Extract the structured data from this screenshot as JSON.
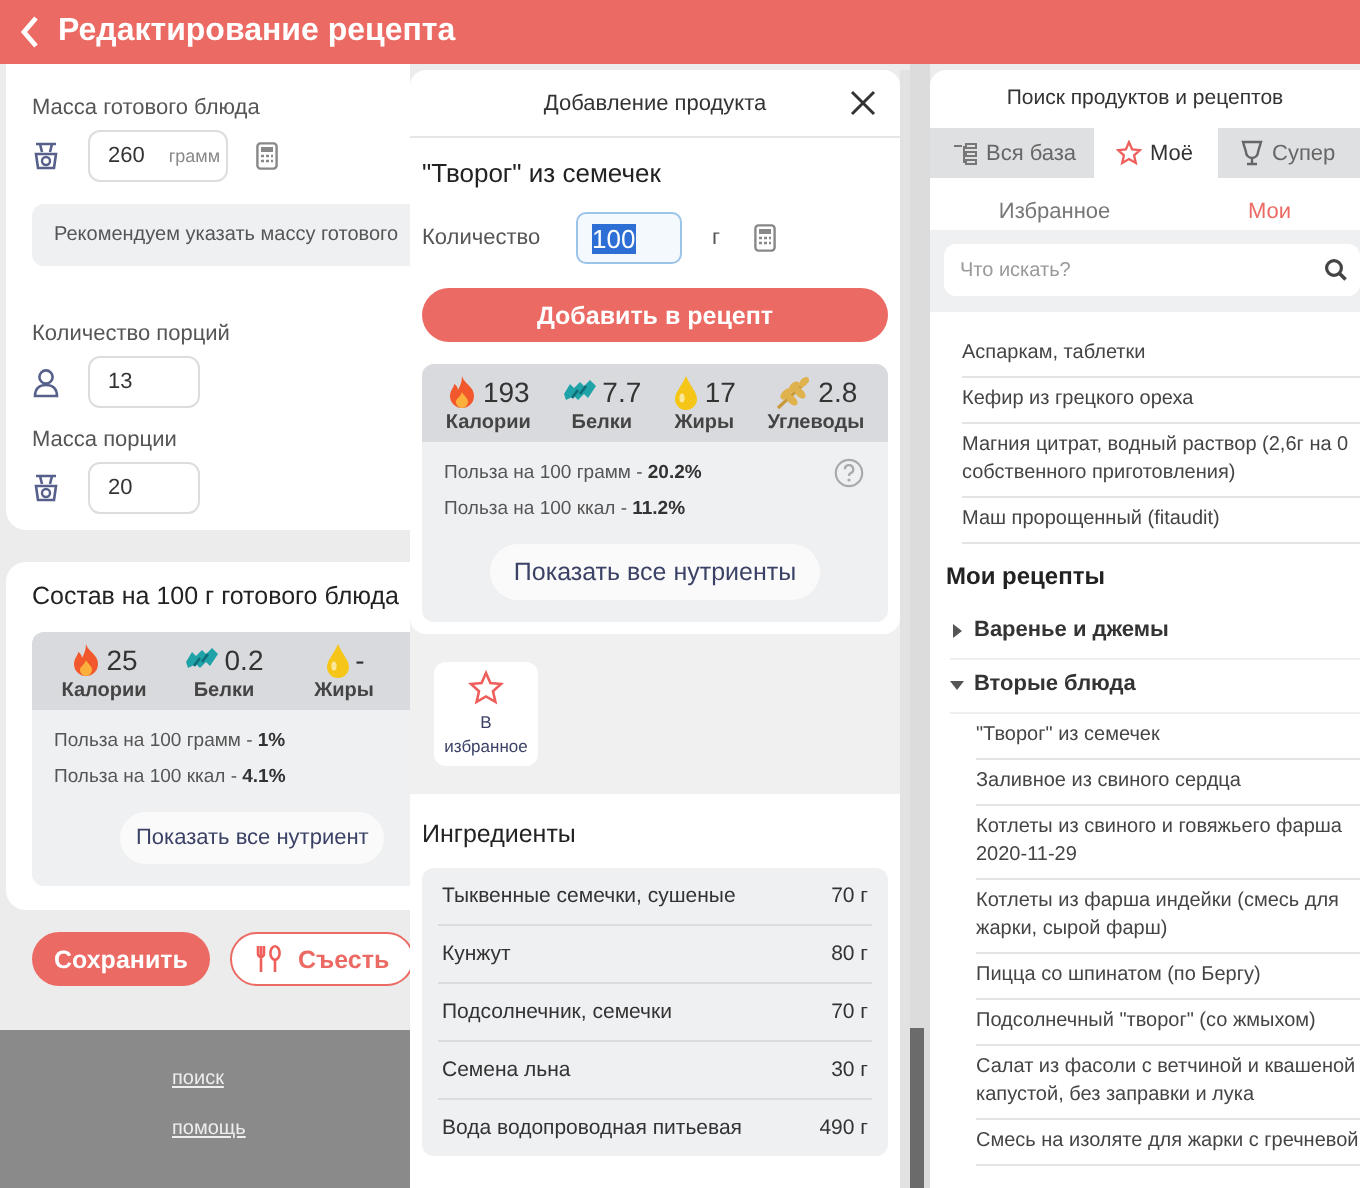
{
  "header": {
    "title": "Редактирование рецепта"
  },
  "recipe": {
    "mass": {
      "label": "Масса готового блюда",
      "value": "260",
      "unit": "грамм"
    },
    "note": "Рекомендуем указать массу готового",
    "portions": {
      "label": "Количество порций",
      "value": "13"
    },
    "portion_mass": {
      "label": "Масса порции",
      "value": "20"
    },
    "composition": {
      "title": "Состав на 100 г готового блюда",
      "nutrients": [
        {
          "kind": "calories",
          "value": "25",
          "label": "Калории"
        },
        {
          "kind": "protein",
          "value": "0.2",
          "label": "Белки"
        },
        {
          "kind": "fat",
          "value": "-",
          "label": "Жиры"
        }
      ],
      "benefits": [
        "Польза на 100 грамм - **1%**",
        "Польза на 100 ккал - **4.1%**"
      ],
      "button": "Показать все нутриент"
    },
    "buttons": [
      {
        "kind": "primary",
        "label": "Сохранить"
      },
      {
        "kind": "eat",
        "label": "Съесть"
      }
    ]
  },
  "footer": {
    "links": [
      "поиск",
      "помощь"
    ]
  },
  "dialog": {
    "title": "Добавление продукта",
    "product": "\"Творог\" из семечек",
    "quantity": {
      "label": "Количество",
      "value": "100",
      "value_selected": true,
      "unit": "г"
    },
    "add_button": "Добавить в рецепт",
    "nutrients": [
      {
        "kind": "calories",
        "value": "193",
        "label": "Калории"
      },
      {
        "kind": "protein",
        "value": "7.7",
        "label": "Белки"
      },
      {
        "kind": "fat",
        "value": "17",
        "label": "Жиры"
      },
      {
        "kind": "carbs",
        "value": "2.8",
        "label": "Углеводы"
      }
    ],
    "benefits": [
      "Польза на 100 грамм - **20.2%**",
      "Польза на 100 ккал - **11.2%**"
    ],
    "nutrients_button": "Показать все нутриенты",
    "favorite": {
      "label": "В избранное"
    },
    "ingredients_title": "Ингредиенты",
    "ingredients": [
      {
        "name": "Тыквенные семечки, сушеные",
        "amount": "70 г"
      },
      {
        "name": "Кунжут",
        "amount": "80 г"
      },
      {
        "name": "Подсолнечник, семечки",
        "amount": "70 г"
      },
      {
        "name": "Семена льна",
        "amount": "30 г"
      },
      {
        "name": "Вода водопроводная питьевая",
        "amount": "490 г"
      }
    ]
  },
  "search_panel": {
    "title": "Поиск продуктов и рецептов",
    "tabs": [
      {
        "kind": "all",
        "label": "Вся база",
        "selected": false
      },
      {
        "kind": "mine",
        "label": "Моё",
        "selected": true
      },
      {
        "kind": "super",
        "label": "Супер",
        "selected": false
      }
    ],
    "subtabs": [
      {
        "label": "Избранное",
        "selected": false
      },
      {
        "label": "Мои",
        "selected": true
      }
    ],
    "search": {
      "placeholder": "Что искать?"
    },
    "products": [
      {
        "lines": [
          "Аспаркам, таблетки"
        ]
      },
      {
        "lines": [
          "Кефир из грецкого ореха"
        ]
      },
      {
        "lines": [
          "Магния цитрат, водный раствор (2,6г на 0",
          "собственного приготовления)"
        ]
      },
      {
        "lines": [
          "Маш пророщенный (fitaudit)"
        ]
      }
    ],
    "recipes_title": "Мои рецепты",
    "folders": [
      {
        "label": "Варенье и джемы",
        "expanded": false
      },
      {
        "label": "Вторые блюда",
        "expanded": true,
        "children": [
          {
            "lines": [
              "\"Творог\" из семечек"
            ]
          },
          {
            "lines": [
              "Заливное из свиного сердца"
            ]
          },
          {
            "lines": [
              "Котлеты из свиного и говяжьего фарша",
              "2020-11-29"
            ]
          },
          {
            "lines": [
              "Котлеты из фарша индейки (смесь для",
              "жарки, сырой фарш)"
            ]
          },
          {
            "lines": [
              "Пицца со шпинатом (по Бергу)"
            ]
          },
          {
            "lines": [
              "Подсолнечный \"творог\" (со жмыхом)"
            ]
          },
          {
            "lines": [
              "Салат из фасоли с ветчиной и квашеной",
              "капустой, без заправки и лука"
            ]
          },
          {
            "lines": [
              "Смесь на изоляте для жарки с гречневой"
            ]
          }
        ]
      }
    ]
  }
}
